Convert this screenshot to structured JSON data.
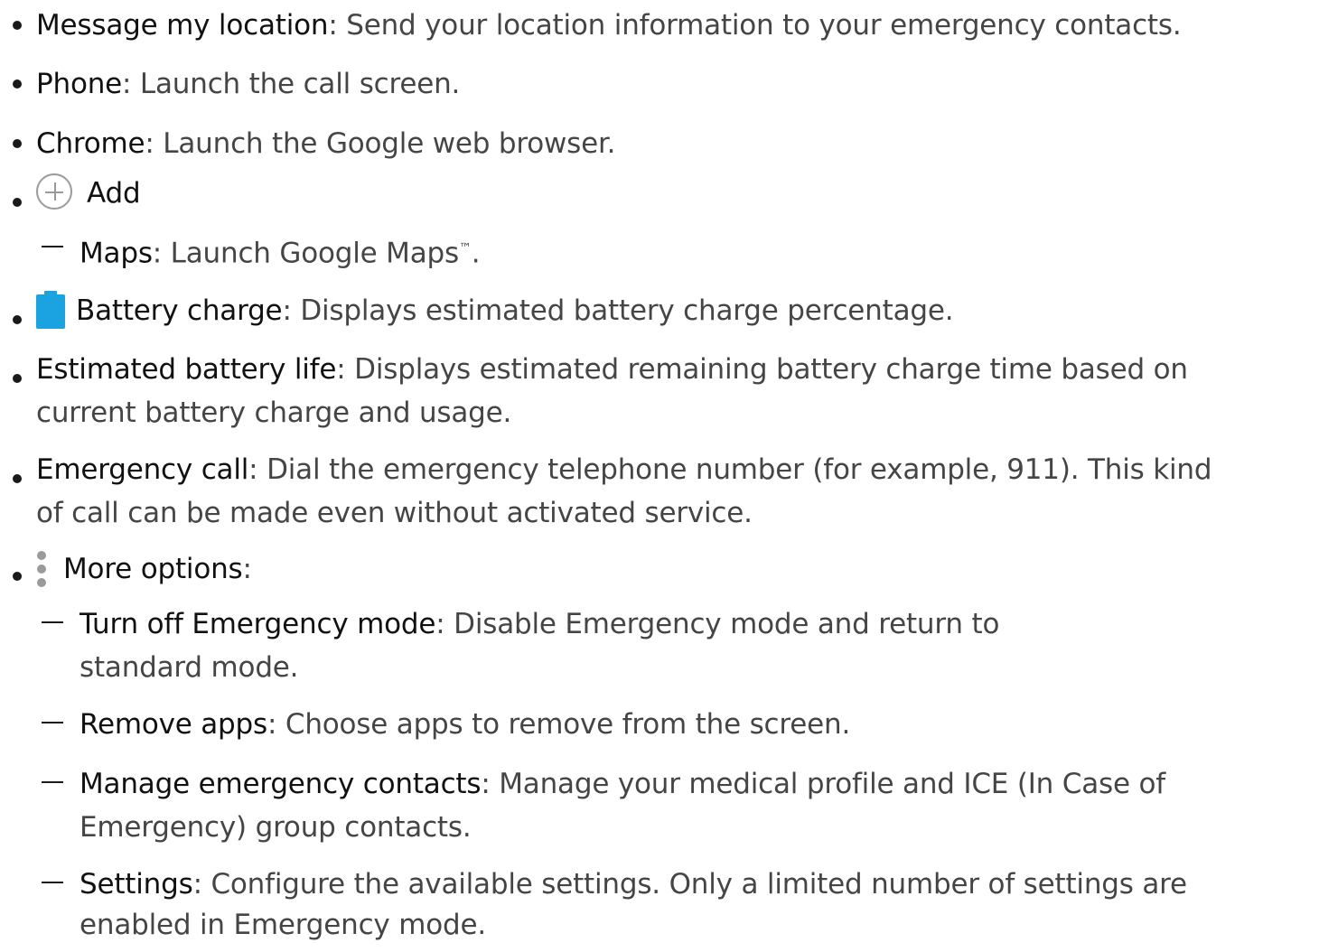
{
  "items": [
    {
      "term": "Message my location",
      "sep": ":",
      "desc": " Send your location information to your emergency contacts."
    },
    {
      "term": "Phone",
      "sep": ":",
      "desc": " Launch the call screen."
    },
    {
      "term": "Chrome",
      "sep": ":",
      "desc": " Launch the Google web browser."
    },
    {
      "icon": "add-circle-icon",
      "term": "Add"
    },
    {
      "sub": true,
      "term": "Maps",
      "sep": ":",
      "desc": " Launch Google Maps",
      "tm": "™",
      "end": "."
    },
    {
      "icon": "battery-icon",
      "term": "Battery charge",
      "sep": ":",
      "desc": " Displays estimated battery charge percentage."
    },
    {
      "term": "Estimated battery life",
      "sep": ":",
      "desc": " Displays estimated remaining battery charge time based on",
      "desc2": "current battery charge and usage."
    },
    {
      "term": "Emergency call",
      "sep": ":",
      "desc": " Dial the emergency telephone number (for example, 911). This kind",
      "desc2": "of call can be made even without activated service."
    },
    {
      "icon": "more-options-icon",
      "term": "More options",
      "sep": ":"
    },
    {
      "sub": true,
      "term": "Turn off Emergency mode",
      "sep": ":",
      "desc": " Disable Emergency mode and return to",
      "desc2": "standard mode."
    },
    {
      "sub": true,
      "term": "Remove apps",
      "sep": ":",
      "desc": " Choose apps to remove from the screen."
    },
    {
      "sub": true,
      "term": "Manage emergency contacts",
      "sep": ":",
      "desc": " Manage your medical profile and ICE (In Case of",
      "desc2": "Emergency) group contacts."
    },
    {
      "sub": true,
      "term": "Settings",
      "sep": ":",
      "desc": " Configure the available settings. Only a limited number of settings are",
      "desc2": "enabled in Emergency mode."
    }
  ],
  "colors": {
    "battery": "#1aa3e0",
    "icon_gray": "#9a9a9a"
  }
}
